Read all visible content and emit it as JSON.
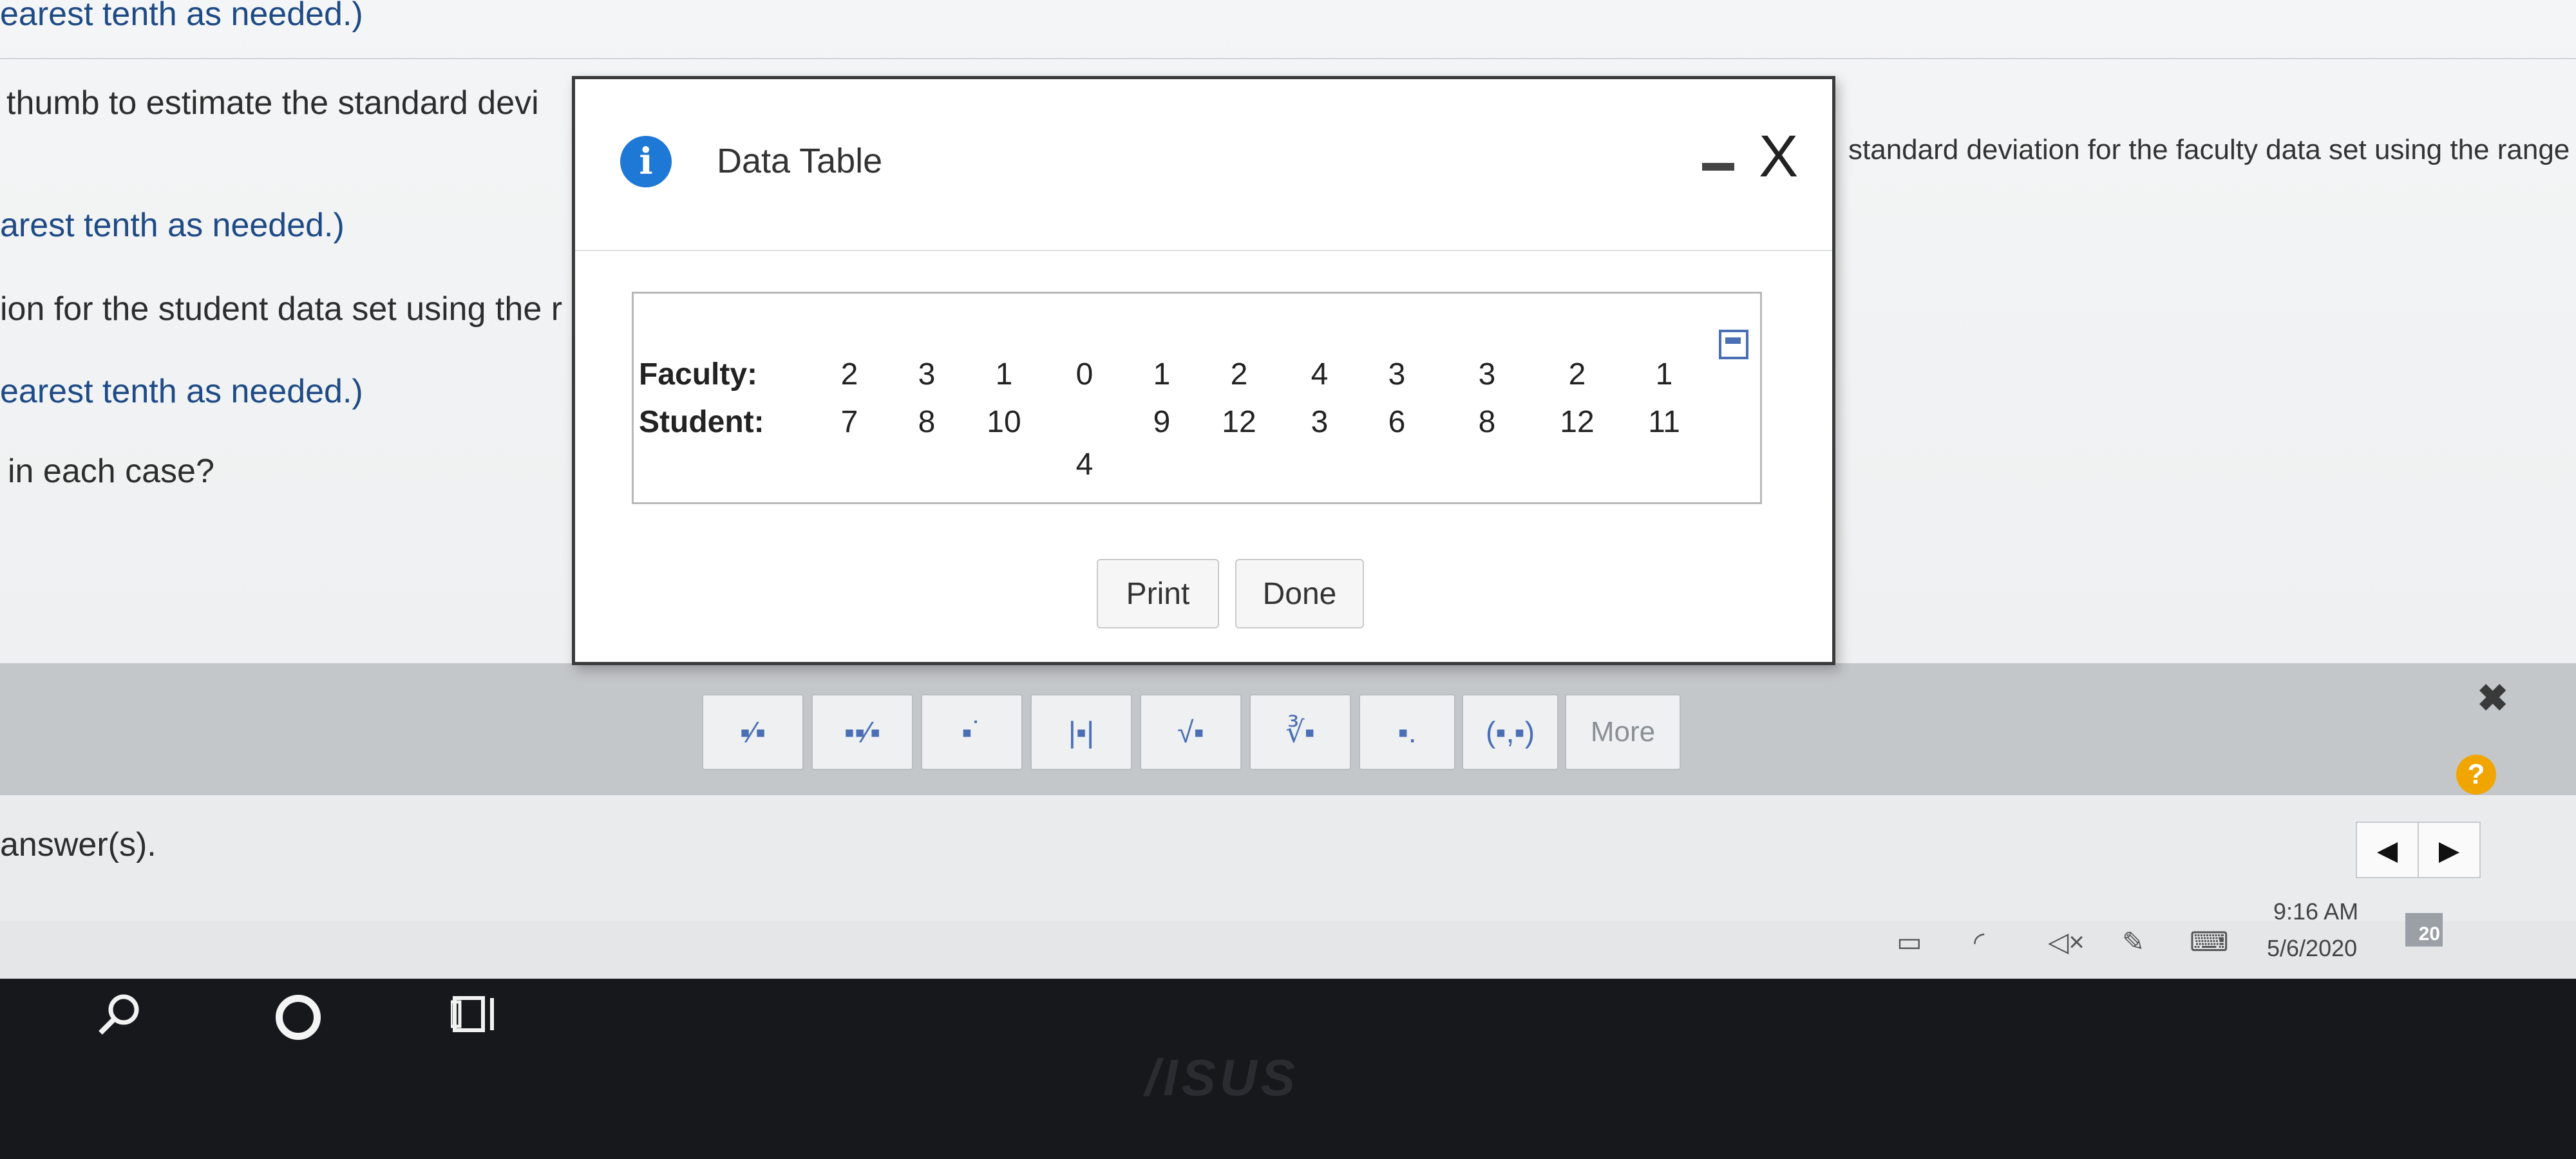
{
  "question": {
    "line1": "earest tenth as needed.)",
    "line2": "thumb to estimate the standard devi",
    "line2_right": "standard deviation for the faculty data set using the range rule",
    "line3": "arest tenth as needed.)",
    "line4": "ion for the student data set using the r",
    "line5": "earest tenth as needed.)",
    "line6": "in each case?"
  },
  "dialog": {
    "title": "Data Table",
    "info_icon": "i",
    "close_glyph": "X",
    "table": {
      "faculty_label": "Faculty:",
      "student_label": "Student:",
      "faculty": [
        "2",
        "3",
        "1",
        "0",
        "1",
        "2",
        "4",
        "3",
        "3",
        "2",
        "1"
      ],
      "student": [
        "7",
        "8",
        "10",
        "4",
        "9",
        "12",
        "3",
        "6",
        "8",
        "12",
        "11"
      ]
    },
    "print_label": "Print",
    "done_label": "Done"
  },
  "palette": {
    "buttons": [
      "fraction-icon",
      "mixed-number-icon",
      "exponent-icon",
      "absolute-value-icon",
      "sqrt-icon",
      "nth-root-icon",
      "subscript-icon",
      "ordered-pair-icon"
    ],
    "glyphs": [
      "▪⁄▪",
      "▪▪⁄▪",
      "▪˙",
      "|▪|",
      "√▪",
      "∛▪",
      "▪.",
      "(▪,▪)"
    ],
    "more_label": "More",
    "close_glyph": "✖"
  },
  "answer": {
    "text": "answer(s).",
    "help_label": "?",
    "prev_glyph": "◀",
    "next_glyph": "▶"
  },
  "taskbar": {
    "time": "9:16 AM",
    "date": "5/6/2020",
    "notification_count": "20"
  },
  "bezel": {
    "brand": "/ISUS"
  }
}
